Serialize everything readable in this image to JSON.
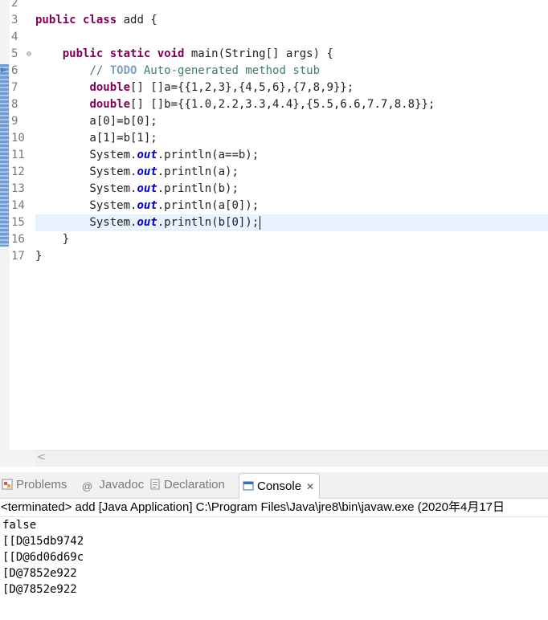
{
  "editor": {
    "line_numbers": [
      "2",
      "3",
      "4",
      "5",
      "6",
      "7",
      "8",
      "9",
      "10",
      "11",
      "12",
      "13",
      "14",
      "15",
      "16",
      "17"
    ],
    "lines": [
      {
        "segments": [
          {
            "t": ""
          }
        ]
      },
      {
        "segments": [
          {
            "t": "public class",
            "c": "kw"
          },
          {
            "t": " add {"
          }
        ]
      },
      {
        "segments": [
          {
            "t": ""
          }
        ]
      },
      {
        "segments": [
          {
            "t": "    "
          },
          {
            "t": "public static void",
            "c": "kw"
          },
          {
            "t": " main(String[] args) {"
          }
        ]
      },
      {
        "segments": [
          {
            "t": "        "
          },
          {
            "t": "// ",
            "c": "cm"
          },
          {
            "t": "TODO",
            "c": "todo"
          },
          {
            "t": " Auto-generated method stub",
            "c": "cm"
          }
        ]
      },
      {
        "segments": [
          {
            "t": "        "
          },
          {
            "t": "double",
            "c": "kw"
          },
          {
            "t": "[] []a={{1,2,3},{4,5,6},{7,8,9}};"
          }
        ]
      },
      {
        "segments": [
          {
            "t": "        "
          },
          {
            "t": "double",
            "c": "kw"
          },
          {
            "t": "[] []b={{1.0,2.2,3.3,4.4},{5.5,6.6,7.7,8.8}};"
          }
        ]
      },
      {
        "segments": [
          {
            "t": "        a[0]=b[0];"
          }
        ]
      },
      {
        "segments": [
          {
            "t": "        a[1]=b[1];"
          }
        ]
      },
      {
        "segments": [
          {
            "t": "        System."
          },
          {
            "t": "out",
            "c": "fld"
          },
          {
            "t": ".println(a==b);"
          }
        ]
      },
      {
        "segments": [
          {
            "t": "        System."
          },
          {
            "t": "out",
            "c": "fld"
          },
          {
            "t": ".println(a);"
          }
        ]
      },
      {
        "segments": [
          {
            "t": "        System."
          },
          {
            "t": "out",
            "c": "fld"
          },
          {
            "t": ".println(b);"
          }
        ]
      },
      {
        "segments": [
          {
            "t": "        System."
          },
          {
            "t": "out",
            "c": "fld"
          },
          {
            "t": ".println(a[0]);"
          }
        ]
      },
      {
        "segments": [
          {
            "t": "        System."
          },
          {
            "t": "out",
            "c": "fld"
          },
          {
            "t": ".println(b[0]);"
          }
        ],
        "current": true
      },
      {
        "segments": [
          {
            "t": "    }"
          }
        ]
      },
      {
        "segments": [
          {
            "t": "}"
          }
        ]
      }
    ],
    "fold_marker_line": "5",
    "fold_glyph": "⊖",
    "hscroll_left_glyph": "<"
  },
  "tabs": [
    {
      "label": "Problems",
      "icon": "problems-icon",
      "active": false
    },
    {
      "label": "Javadoc",
      "icon": "javadoc-icon",
      "active": false
    },
    {
      "label": "Declaration",
      "icon": "declaration-icon",
      "active": false
    },
    {
      "label": "Console",
      "icon": "console-icon",
      "active": true
    }
  ],
  "console": {
    "header": "<terminated> add [Java Application] C:\\Program Files\\Java\\jre8\\bin\\javaw.exe (2020年4月17日",
    "output": [
      "false",
      "[[D@15db9742",
      "[[D@6d06d69c",
      "[D@7852e922",
      "[D@7852e922"
    ]
  },
  "colors": {
    "keyword": "#7f0055",
    "comment": "#3f7f5f",
    "todo": "#7f9fbf",
    "static_field": "#0000c0",
    "current_line": "#e8f2fe"
  }
}
